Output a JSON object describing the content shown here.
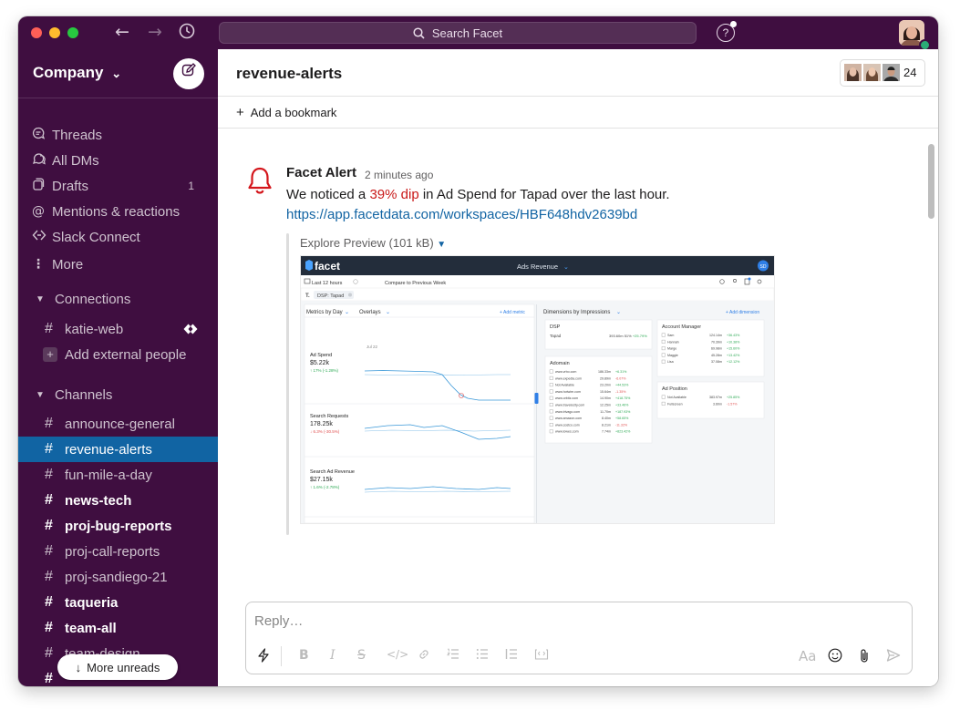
{
  "topbar": {
    "search_placeholder": "Search Facet",
    "help_label": "?"
  },
  "sidebar": {
    "workspace_name": "Company",
    "workspace_caret": "⌄",
    "nav_items": [
      {
        "label": "Threads",
        "icon": "threads-icon"
      },
      {
        "label": "All DMs",
        "icon": "dms-icon"
      },
      {
        "label": "Drafts",
        "icon": "drafts-icon",
        "count": "1"
      },
      {
        "label": "Mentions & reactions",
        "icon": "mentions-icon"
      },
      {
        "label": "Slack Connect",
        "icon": "slack-connect-icon"
      },
      {
        "label": "More",
        "icon": "more-icon"
      }
    ],
    "connections": {
      "header": "Connections",
      "items": [
        {
          "label": "katie-web"
        },
        {
          "label": "Add external people"
        }
      ]
    },
    "channels": {
      "header": "Channels",
      "items": [
        {
          "label": "announce-general",
          "bold": false,
          "active": false
        },
        {
          "label": "revenue-alerts",
          "bold": false,
          "active": true
        },
        {
          "label": "fun-mile-a-day",
          "bold": false,
          "active": false
        },
        {
          "label": "news-tech",
          "bold": true,
          "active": false
        },
        {
          "label": "proj-bug-reports",
          "bold": true,
          "active": false
        },
        {
          "label": "proj-call-reports",
          "bold": false,
          "active": false
        },
        {
          "label": "proj-sandiego-21",
          "bold": false,
          "active": false
        },
        {
          "label": "taqueria",
          "bold": true,
          "active": false
        },
        {
          "label": "team-all",
          "bold": true,
          "active": false
        },
        {
          "label": "team-design",
          "bold": false,
          "active": false
        }
      ]
    },
    "more_unreads": "More unreads"
  },
  "channel": {
    "title": "revenue-alerts",
    "member_count": "24",
    "bookmark_label": "Add a bookmark"
  },
  "message": {
    "author": "Facet Alert",
    "time": "2 minutes ago",
    "text_before": "We noticed a ",
    "text_highlight": "39% dip",
    "text_after": " in Ad Spend for Tapad over the last hour.",
    "link": "https://app.facetdata.com/workspaces/HBF648hdv2639bd",
    "attachment_title": "Explore Preview (101 kB)"
  },
  "preview": {
    "logo": "facet",
    "app_title": "Ads Revenue",
    "user_initials": "SD",
    "time_range": "Last 12 hours",
    "compare": "Compare to Previous Week",
    "filter_chip": "DSP: Tapad",
    "metrics_tab": "Metrics by Day",
    "overlays_tab": "Overlays",
    "add_metric": "+ Add metric",
    "dimensions_tab": "Dimensions by Impressions",
    "add_dimension": "+ Add dimension",
    "date_label": "Jul 22",
    "metrics": [
      {
        "name": "Ad Spend",
        "value": "$5.22k",
        "change": "17% (-1.28%)",
        "dir": "up"
      },
      {
        "name": "Search Requests",
        "value": "178.25k",
        "change": "6.3% (-30.5%)",
        "dir": "down"
      },
      {
        "name": "Search Ad Revenue",
        "value": "$27.15k",
        "change": "1.6% (-2.78%)",
        "dir": "up"
      }
    ],
    "dsp_panel": {
      "title": "DSP",
      "rows": [
        {
          "name": "Tapad",
          "value": "393.60m",
          "pct": "51%",
          "delta": "+25.79%"
        }
      ]
    },
    "adomain_panel": {
      "title": "Adomain",
      "rows": [
        {
          "name": "www.vrbo.com",
          "value": "186.33m",
          "delta": "+6.31%"
        },
        {
          "name": "www.expedia.com",
          "value": "29.89m",
          "delta": "-6.07%"
        },
        {
          "name": "Not Available",
          "value": "23.20m",
          "delta": "+44.53%"
        },
        {
          "name": "www.hotwire.com",
          "value": "15.64m",
          "delta": "-1.35%"
        },
        {
          "name": "www.orbitz.com",
          "value": "14.90m",
          "delta": "+418.75%"
        },
        {
          "name": "www.travelocity.com",
          "value": "12.25m",
          "delta": "+33.46%"
        },
        {
          "name": "www.trivago.com",
          "value": "11.70m",
          "delta": "+187.93%"
        },
        {
          "name": "www.amazon.com",
          "value": "8.40m",
          "delta": "+58.65%"
        },
        {
          "name": "www.costco.com",
          "value": "8.21m",
          "delta": "-11.32%"
        },
        {
          "name": "www.lowes.com",
          "value": "7.74m",
          "delta": "+823.42%"
        }
      ]
    },
    "account_panel": {
      "title": "Account Manager",
      "rows": [
        {
          "name": "Sam",
          "value": "124.14m",
          "delta": "+36.43%"
        },
        {
          "name": "Hannah",
          "value": "70.39m",
          "delta": "+10.38%"
        },
        {
          "name": "Marge",
          "value": "69.98m",
          "delta": "+15.60%"
        },
        {
          "name": "Maggie",
          "value": "45.28m",
          "delta": "+13.42%"
        },
        {
          "name": "Lisa",
          "value": "37.08m",
          "delta": "+12.12%"
        }
      ]
    },
    "adposition_panel": {
      "title": "Ad Position",
      "rows": [
        {
          "name": "Not Available",
          "value": "383.97m",
          "delta": "+25.85%"
        },
        {
          "name": "Fullscreen",
          "value": "3.60m",
          "delta": "-1.57%"
        }
      ]
    }
  },
  "composer": {
    "placeholder": "Reply…",
    "format_label": "Aa"
  }
}
